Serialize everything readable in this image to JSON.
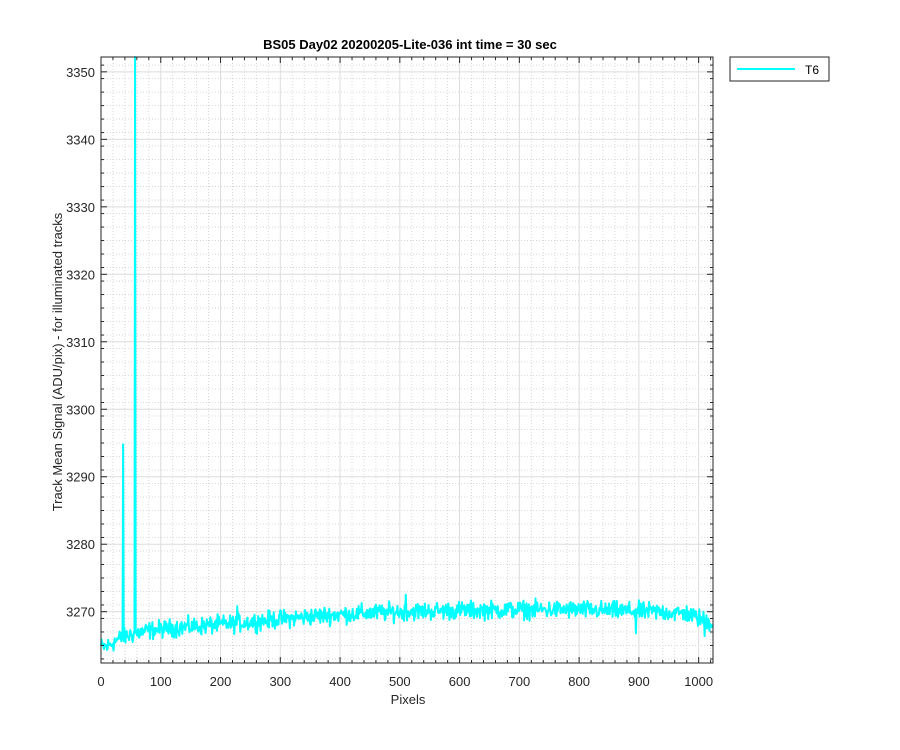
{
  "chart_data": {
    "type": "line",
    "title": "BS05 Day02 20200205-Lite-036 int time = 30 sec",
    "xlabel": "Pixels",
    "ylabel": "Track Mean Signal (ADU/pix) - for illuminated tracks",
    "xlim": [
      0,
      1024
    ],
    "ylim": [
      3262.4,
      3352.2
    ],
    "xticks": [
      0,
      100,
      200,
      300,
      400,
      500,
      600,
      700,
      800,
      900,
      1000
    ],
    "yticks": [
      3270,
      3280,
      3290,
      3300,
      3310,
      3320,
      3330,
      3340,
      3350
    ],
    "grid": "major-solid-minor-dotted",
    "legend_position": "outside-top-right",
    "series": [
      {
        "name": "T6",
        "color": "#00ffff",
        "baseline": {
          "x": [
            0,
            10,
            30,
            50,
            80,
            120,
            170,
            230,
            300,
            380,
            450,
            500,
            600,
            700,
            800,
            880,
            930,
            980,
            1023
          ],
          "y": [
            3264.8,
            3264.8,
            3266,
            3266.6,
            3267.2,
            3267.6,
            3267.9,
            3268.3,
            3268.9,
            3269.5,
            3269.8,
            3270.0,
            3270.2,
            3270.3,
            3270.3,
            3270.1,
            3270.0,
            3269.7,
            3268.3
          ]
        },
        "noise_amplitude": 1.3,
        "spikes": [
          {
            "x": 37,
            "y": 3294.8
          },
          {
            "x": 57,
            "y": 3352.2
          }
        ],
        "notable_points": [
          {
            "x": 228,
            "y": 3270.8
          },
          {
            "x": 510,
            "y": 3272.5
          },
          {
            "x": 895,
            "y": 3266.8
          },
          {
            "x": 1010,
            "y": 3266.4
          }
        ]
      }
    ]
  }
}
